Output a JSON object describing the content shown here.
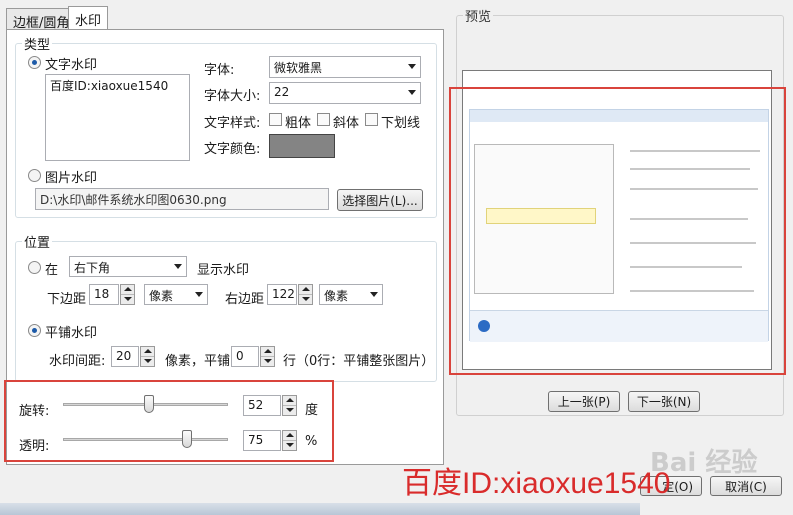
{
  "tabs": {
    "border": "边框/圆角",
    "watermark": "水印"
  },
  "type_group": {
    "legend": "类型",
    "text_wm_label": "文字水印",
    "text_wm_value": "百度ID:xiaoxue1540",
    "font_label": "字体:",
    "font_value": "微软雅黑",
    "size_label": "字体大小:",
    "size_value": "22",
    "style_label": "文字样式:",
    "bold": "粗体",
    "italic": "斜体",
    "underline": "下划线",
    "color_label": "文字颜色:",
    "text_color": "#848484",
    "image_wm_label": "图片水印",
    "image_path": "D:\\水印\\邮件系统水印图0630.png",
    "choose_image": "选择图片(L)..."
  },
  "position_group": {
    "legend": "位置",
    "at_label": "在",
    "corner_value": "右下角",
    "show_label": "显示水印",
    "bottom_margin_label": "下边距",
    "bottom_margin_value": "18",
    "bottom_unit": "像素",
    "right_margin_label": "右边距",
    "right_margin_value": "122",
    "right_unit": "像素",
    "tile_label": "平铺水印",
    "spacing_label": "水印间距:",
    "spacing_value": "20",
    "tile_mid": "像素，平铺",
    "tile_rows_value": "0",
    "tile_suffix": "行（0行：平铺整张图片）"
  },
  "rotate": {
    "label": "旋转:",
    "value": "52",
    "unit": "度",
    "level": 0.52
  },
  "opacity": {
    "label": "透明:",
    "value": "75",
    "unit": "%",
    "level": 0.75
  },
  "preview": {
    "label": "预览",
    "prev_button": "上一张(P)",
    "next_button": "下一张(N)"
  },
  "footer": {
    "ok_button": "定(O)",
    "cancel_button": "取消(C)",
    "overlay_text": "百度ID:xiaoxue1540",
    "baidu_watermark": "Bai 经验"
  },
  "colors": {
    "highlight_red": "#d9443c",
    "overlay_red": "#d92b2b"
  }
}
